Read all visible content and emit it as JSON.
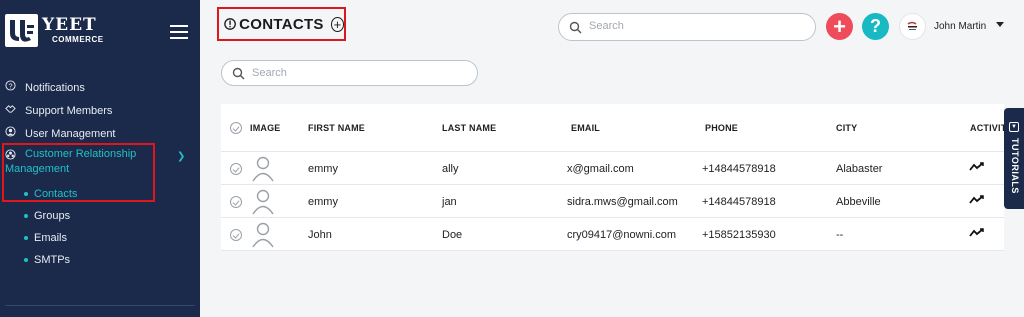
{
  "brand": {
    "line1": "YEET",
    "line2": "COMMERCE"
  },
  "sidebar": {
    "items": [
      {
        "label": "Notifications",
        "icon": "info-circle-icon"
      },
      {
        "label": "Support Members",
        "icon": "handshake-icon"
      },
      {
        "label": "User Management",
        "icon": "users-icon"
      },
      {
        "label_line1": "Customer Relationship",
        "label_line2": "Management",
        "icon": "crm-icon",
        "expanded": true
      }
    ],
    "sub_items": [
      {
        "label": "Contacts",
        "active": true
      },
      {
        "label": "Groups"
      },
      {
        "label": "Emails"
      },
      {
        "label": "SMTPs"
      }
    ]
  },
  "header": {
    "title": "CONTACTS",
    "search_placeholder": "Search",
    "add_icon": "plus-icon",
    "help_icon": "question-icon",
    "user_name": "John Martin"
  },
  "list": {
    "search_placeholder": "Search",
    "columns": [
      "IMAGE",
      "FIRST NAME",
      "LAST NAME",
      "EMAIL",
      "PHONE",
      "CITY",
      "ACTIVITY"
    ],
    "rows": [
      {
        "first": "emmy",
        "last": "ally",
        "email": "x@gmail.com",
        "phone": "+14844578918",
        "city": "Alabaster"
      },
      {
        "first": "emmy",
        "last": "jan",
        "email": "sidra.mws@gmail.com",
        "phone": "+14844578918",
        "city": "Abbeville"
      },
      {
        "first": "John",
        "last": "Doe",
        "email": "cry09417@nowni.com",
        "phone": "+15852135930",
        "city": "--"
      }
    ]
  },
  "tutorials": {
    "label": "TUTORIALS"
  },
  "colors": {
    "sidebar": "#1b2a4a",
    "accent": "#21c0c8",
    "highlight": "#e0161d",
    "add": "#ee4b5b",
    "help": "#18b9c3"
  }
}
